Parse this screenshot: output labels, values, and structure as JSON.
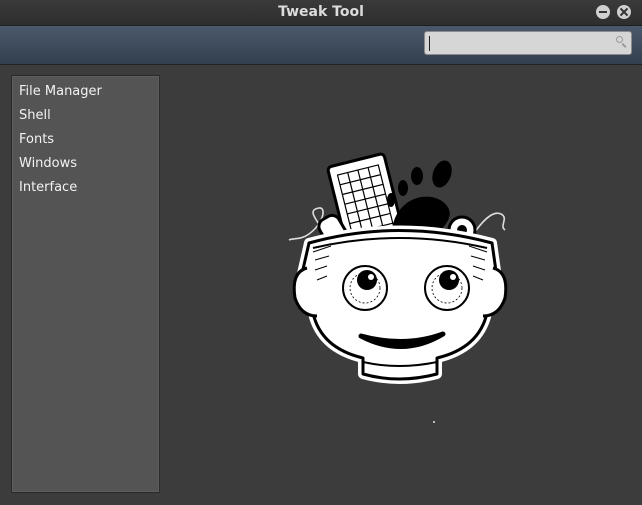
{
  "window": {
    "title": "Tweak Tool"
  },
  "toolbar": {
    "search": {
      "value": "",
      "placeholder": ""
    }
  },
  "sidebar": {
    "items": [
      {
        "label": "File Manager"
      },
      {
        "label": "Shell"
      },
      {
        "label": "Fonts"
      },
      {
        "label": "Windows"
      },
      {
        "label": "Interface"
      }
    ]
  },
  "icons": {
    "minimize": "minimize-icon",
    "close": "close-icon",
    "search": "search-icon",
    "mascot": "tweak-tool-mascot-icon"
  },
  "colors": {
    "titlebar": "#2e2e2e",
    "toolbar": "#3d4a5b",
    "window_bg": "#3c3c3c",
    "sidebar_bg": "#545454",
    "text": "#f2f2f2"
  }
}
